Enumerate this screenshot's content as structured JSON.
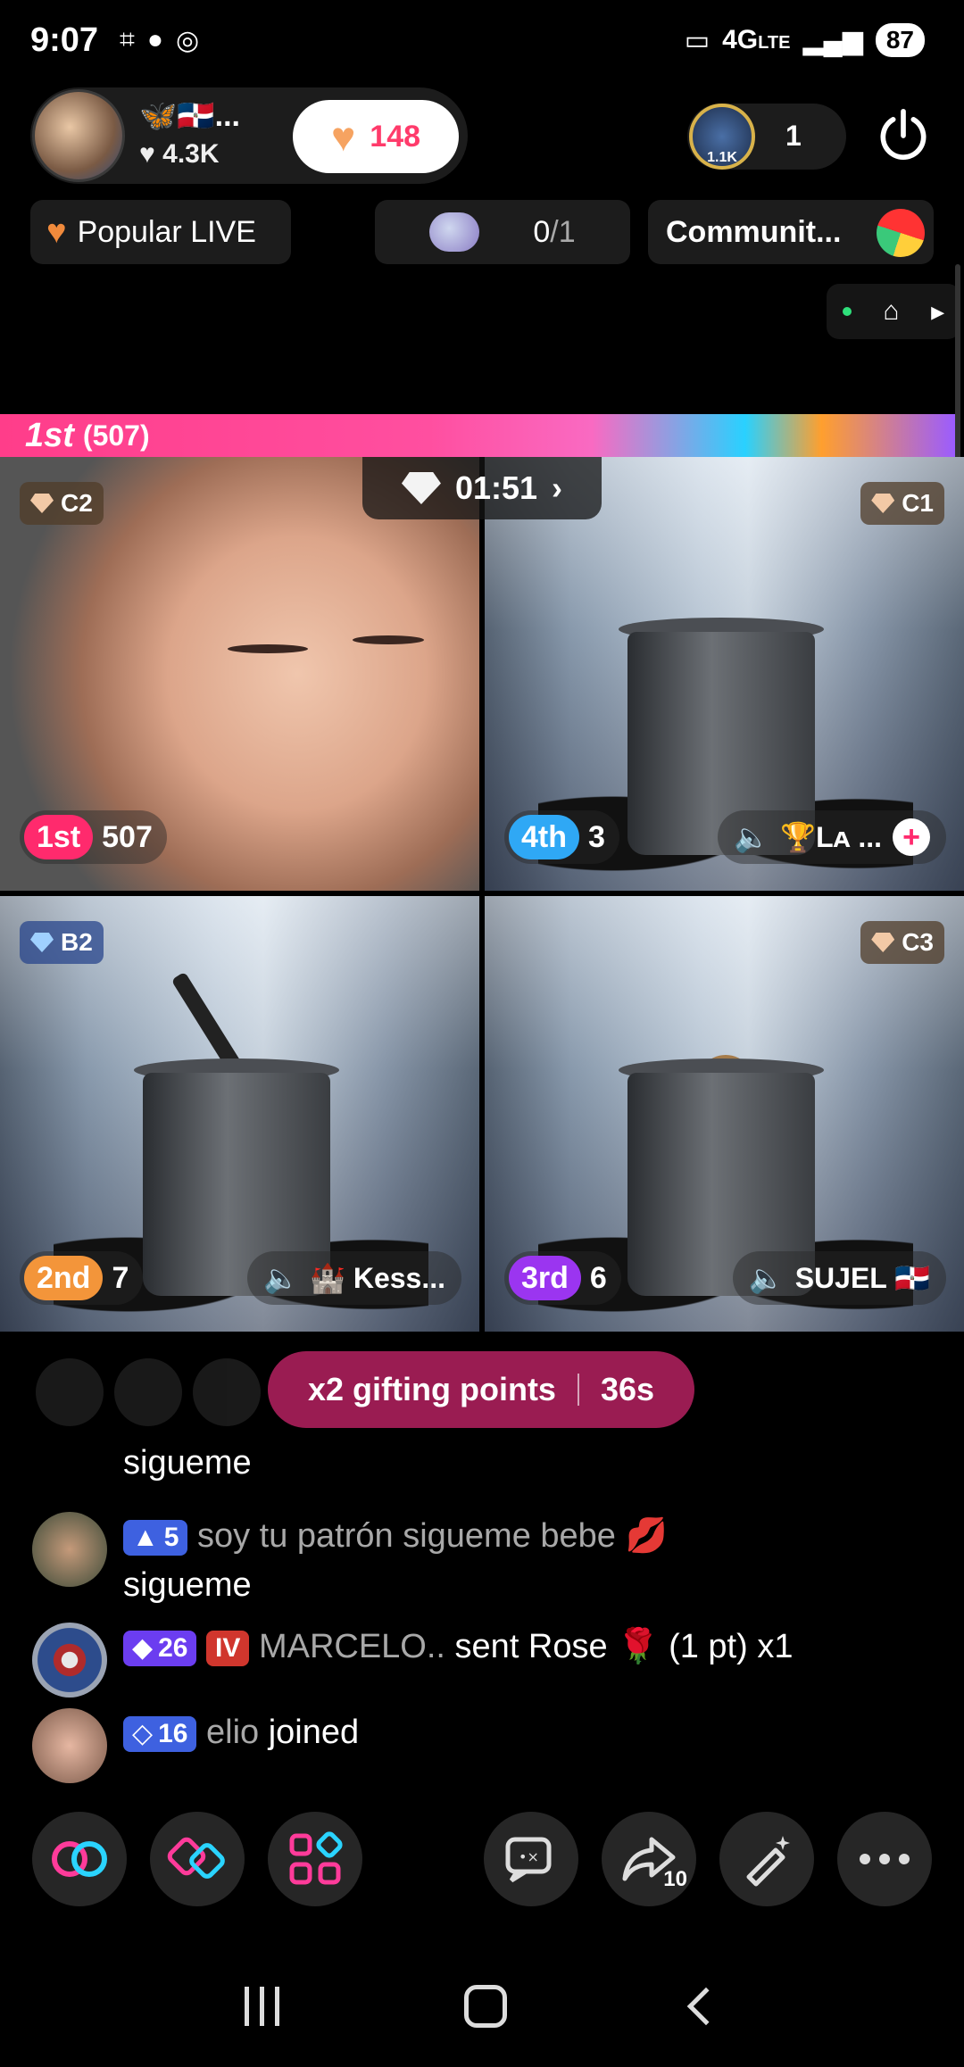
{
  "status_bar": {
    "time": "9:07",
    "network": "4G",
    "network_suffix": "LTE",
    "battery": "87",
    "icons_left": [
      "screenshot-icon",
      "chat-bubble-icon",
      "instagram-icon"
    ],
    "icons_right": [
      "cast-icon",
      "signal-icon"
    ]
  },
  "host": {
    "name": "🦋🇩🇴...",
    "likes": "4.3K",
    "like_count": "148"
  },
  "viewers": {
    "badge": "1.1K",
    "count": "1"
  },
  "chips": {
    "popular": "Popular LIVE",
    "goal_current": "0",
    "goal_total": "/1",
    "community": "Communit..."
  },
  "battle": {
    "leader_label": "1st",
    "leader_points": "(507)",
    "timer": "01:51"
  },
  "tiles": [
    {
      "gem": "C2",
      "rank": "1st",
      "score": "507",
      "name": ""
    },
    {
      "gem": "C1",
      "rank": "4th",
      "score": "3",
      "name": "🏆Lᴀ ..."
    },
    {
      "gem": "B2",
      "rank": "2nd",
      "score": "7",
      "name": "🏰 Kess..."
    },
    {
      "gem": "C3",
      "rank": "3rd",
      "score": "6",
      "name": "SUJEL 🇩🇴"
    }
  ],
  "gift_toast": {
    "label": "x2 gifting points",
    "countdown": "36s"
  },
  "chat": [
    {
      "user": "",
      "badge": "",
      "message": "sigueme"
    },
    {
      "user": "soy tu patrón sigueme  bebe 💋",
      "badge": "5",
      "message": "sigueme"
    },
    {
      "user": "MARCELO..",
      "badge": "26",
      "message": "sent Rose 🌹 (1 pt) x1"
    },
    {
      "user": "elio",
      "badge": "16",
      "message": "joined"
    }
  ],
  "toolbar": {
    "share_count": "10"
  },
  "colors": {
    "accent_pink": "#ff2a6d",
    "toast_bg": "#9a1c52",
    "rank_1st": "#ff2a6d",
    "rank_2nd": "#f3953a",
    "rank_3rd": "#9b35f0",
    "rank_4th": "#2fa8f5"
  }
}
